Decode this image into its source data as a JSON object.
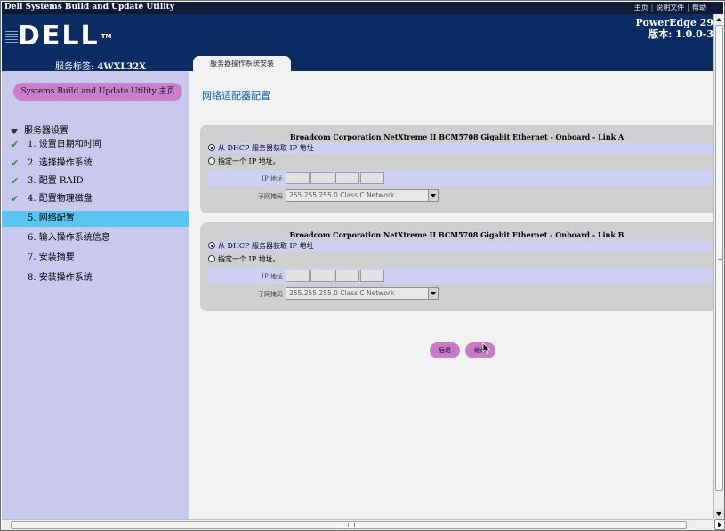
{
  "window": {
    "title": "Dell Systems Build and Update Utility",
    "links": [
      "主页",
      "说明文件",
      "帮助"
    ]
  },
  "header": {
    "logo": "DELL",
    "logo_tm": "TM",
    "product_model": "PowerEdge 29",
    "version": "版本: 1.0.0-3",
    "service_tag_label": "服务标签:",
    "service_tag_value": "4WXL32X",
    "tab_label": "服务器操作系统安装"
  },
  "sidebar": {
    "home_button": "Systems Build and Update Utility 主页",
    "root_label": "服务器设置",
    "items": [
      {
        "label": "1. 设置日期和时间",
        "done": true
      },
      {
        "label": "2. 选择操作系统",
        "done": true
      },
      {
        "label": "3. 配置 RAID",
        "done": true
      },
      {
        "label": "4. 配置物理磁盘",
        "done": true
      },
      {
        "label": "5. 网络配置",
        "done": false,
        "active": true
      },
      {
        "label": "6. 输入操作系统信息",
        "done": false
      },
      {
        "label": "7. 安装摘要",
        "done": false
      },
      {
        "label": "8. 安装操作系统",
        "done": false
      }
    ],
    "check_icon": "✔",
    "active_color": "#58c6f0"
  },
  "main": {
    "page_title": "网络适配器配置",
    "adapters": [
      {
        "title": "Broadcom Corporation NetXtreme II BCM5708 Gigabit Ethernet - Onboard - Link A",
        "dhcp_label": "从 DHCP 服务器获取 IP 地址",
        "static_label": "指定一个 IP 地址。",
        "ip_label": "IP 地址",
        "subnet_label": "子网掩码",
        "subnet_value": "255.255.255.0 Class C Network",
        "dhcp_selected": true
      },
      {
        "title": "Broadcom Corporation NetXtreme II BCM5708 Gigabit Ethernet - Onboard - Link B",
        "dhcp_label": "从 DHCP 服务器获取 IP 地址",
        "static_label": "指定一个 IP 地址。",
        "ip_label": "IP 地址",
        "subnet_label": "子网掩码",
        "subnet_value": "255.255.255.0 Class C Network",
        "dhcp_selected": true
      }
    ],
    "back_button": "后退",
    "next_button": "继续"
  },
  "colors": {
    "header_bg": "#0b2b63",
    "sidebar_bg": "#c9c9ee",
    "button_bg": "#c979c9",
    "title_color": "#0b5f9e"
  }
}
